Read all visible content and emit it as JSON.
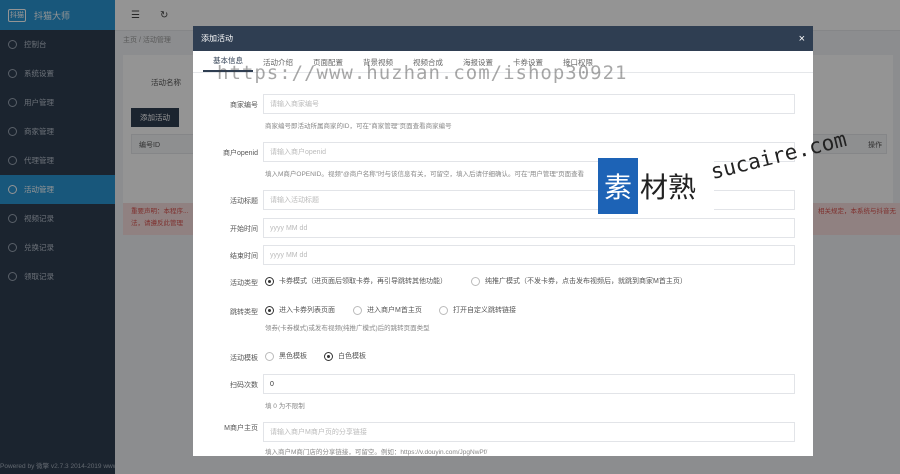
{
  "brand": {
    "logo": "抖猫",
    "name": "抖猫大师"
  },
  "sidebar": {
    "items": [
      {
        "label": "控制台",
        "icon": "dashboard-icon",
        "active": false
      },
      {
        "label": "系统设置",
        "icon": "settings-icon",
        "active": false
      },
      {
        "label": "用户管理",
        "icon": "user-icon",
        "active": false
      },
      {
        "label": "商家管理",
        "icon": "store-icon",
        "active": false
      },
      {
        "label": "代理管理",
        "icon": "agent-icon",
        "active": false
      },
      {
        "label": "活动管理",
        "icon": "activity-icon",
        "active": true
      },
      {
        "label": "视频记录",
        "icon": "video-icon",
        "active": false
      },
      {
        "label": "兑换记录",
        "icon": "exchange-icon",
        "active": false
      },
      {
        "label": "领取记录",
        "icon": "record-icon",
        "active": false
      }
    ],
    "powered": "Powered by 微擎 v2.7.3 2014-2019 www.w7.cc"
  },
  "topbar": {
    "menu_icon": "☰",
    "refresh_icon": "↻"
  },
  "background": {
    "breadcrumb": "主页 / 活动管理",
    "search_label": "活动名称",
    "add_button": "添加活动",
    "col_id": "编号ID",
    "col_action": "操作",
    "notice": "重要声明：本程序...",
    "notice_right": "相关规定，本系统与抖音无",
    "notice_line2": "法，请遵反此管理"
  },
  "watermark": {
    "url": "https://www.huzhan.com/ishop30921",
    "badge_first": "素",
    "badge_rest": "材熟",
    "badge_domain": "sucaire.com"
  },
  "modal": {
    "title": "添加活动",
    "close": "×",
    "tabs": [
      "基本信息",
      "活动介绍",
      "页面配置",
      "背景视频",
      "视频合成",
      "海报设置",
      "卡券设置",
      "接口权限"
    ],
    "fields": {
      "shop_no": {
        "label": "商家编号",
        "placeholder": "请输入商家编号",
        "help": "商家编号即活动所属商家的ID，可在\"商家管理\"页面查看商家编号"
      },
      "openid": {
        "label": "商户openid",
        "placeholder": "请输入商户openid",
        "help": "填入M商户OPENID。视频\"@商户名称\"时与该信息有关，可留空，填入后请仔细确认。可在\"用户管理\"页面查看"
      },
      "title": {
        "label": "活动标题",
        "placeholder": "请输入活动标题"
      },
      "start": {
        "label": "开始时间",
        "placeholder": "yyyy MM dd"
      },
      "end": {
        "label": "结束时间",
        "placeholder": "yyyy MM dd"
      },
      "type": {
        "label": "活动类型",
        "options": [
          "卡券模式（进页面后领取卡券，再引导跳转其他功能）",
          "纯推广模式（不发卡券，点击发布视频后，就跳到商家M首主页）"
        ],
        "selected": 0
      },
      "jump": {
        "label": "跳转类型",
        "options": [
          "进入卡券列表页面",
          "进入商户M首主页",
          "打开自定义跳转链接"
        ],
        "selected": 0,
        "help": "领券(卡券模式)或发布视频(纯推广模式)后的跳转页面类型"
      },
      "template": {
        "label": "活动模板",
        "options": [
          "黑色模板",
          "白色模板"
        ],
        "selected": 1
      },
      "times": {
        "label": "扫码次数",
        "value": "0",
        "help": "填 0 为不限制"
      },
      "mpage": {
        "label": "M商户主页",
        "placeholder": "请输入商户M商户页的分享链接",
        "help": "填入商户M商门店的分享链接，可留空。例如：https://v.douyin.com/JpgNwPf/"
      }
    }
  }
}
